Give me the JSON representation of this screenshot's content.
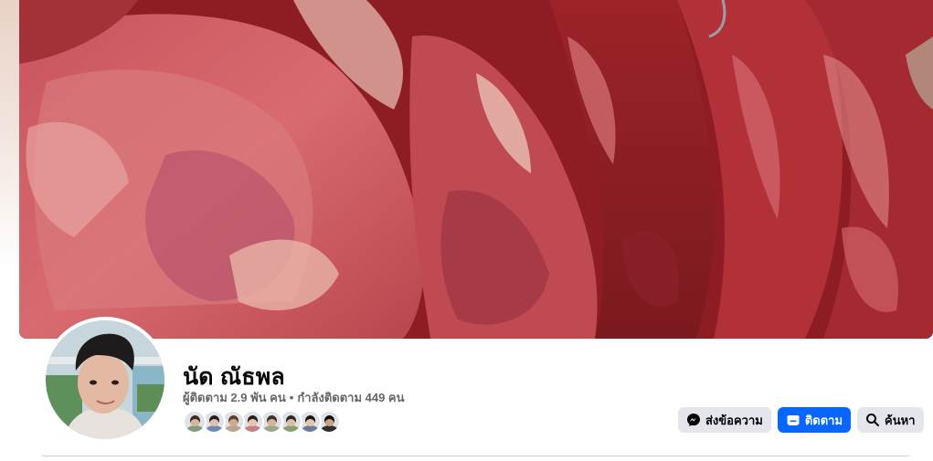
{
  "cover": {
    "image": "hanging-beef-carcasses"
  },
  "profile": {
    "avatar": "profile-photo-young-man",
    "name": "นัด ณัธพล",
    "followers_text": "ผู้ติดตาม 2.9 พัน คน",
    "separator": "•",
    "following_text": "กำลังติดตาม 449 คน",
    "follower_faces": [
      {
        "skin": "#d9b59a",
        "hair": "#3b2a22",
        "shirt": "#7f9d7a"
      },
      {
        "skin": "#e2c1a8",
        "hair": "#1d1d1d",
        "shirt": "#6a8bb0"
      },
      {
        "skin": "#cfa98c",
        "hair": "#5a4030",
        "shirt": "#b7a58c"
      },
      {
        "skin": "#e8c6ad",
        "hair": "#2a1c16",
        "shirt": "#c97f86"
      },
      {
        "skin": "#d6b49a",
        "hair": "#3d3326",
        "shirt": "#9aa88a"
      },
      {
        "skin": "#dcbfa6",
        "hair": "#2b2620",
        "shirt": "#8a9e6e"
      },
      {
        "skin": "#e5c5ae",
        "hair": "#1c1612",
        "shirt": "#6c7b96"
      },
      {
        "skin": "#c9a184",
        "hair": "#0f0f0f",
        "shirt": "#2e2e2e"
      }
    ]
  },
  "actions": {
    "message": {
      "label": "ส่งข้อความ",
      "icon": "messenger-icon"
    },
    "follow": {
      "label": "ติดตาม",
      "icon": "follow-icon"
    },
    "search": {
      "label": "ค้นหา",
      "icon": "search-icon"
    }
  },
  "colors": {
    "primary_button": "#0866ff",
    "secondary_button": "#e4e6eb",
    "secondary_text": "#65676b"
  }
}
